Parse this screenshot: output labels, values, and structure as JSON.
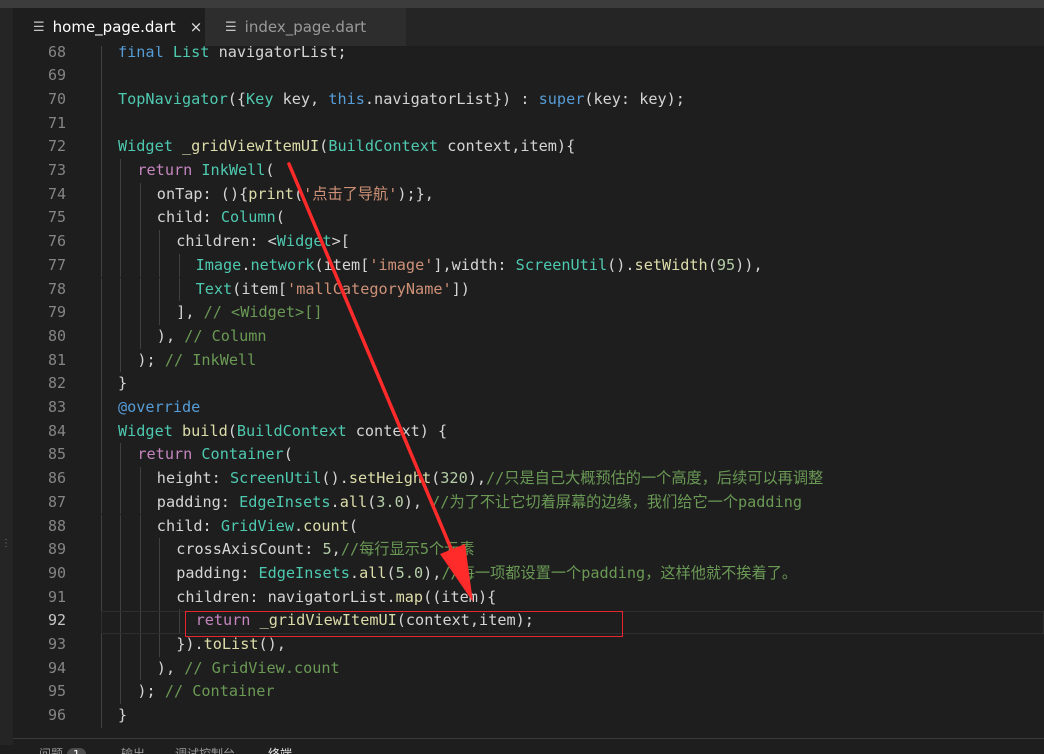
{
  "tabs": [
    {
      "label": "home_page.dart",
      "active": true,
      "icon": "lines-file-icon",
      "close": "×"
    },
    {
      "label": "index_page.dart",
      "active": false,
      "icon": "lines-file-icon"
    }
  ],
  "editor": {
    "active_line": 92,
    "lines": [
      {
        "n": "68",
        "indent": 1,
        "cut": true,
        "tokens": [
          {
            "t": "final ",
            "c": "kw"
          },
          {
            "t": "List ",
            "c": "ty"
          },
          {
            "t": "navigatorList;",
            "c": "pl"
          }
        ]
      },
      {
        "n": "69",
        "indent": 1,
        "tokens": []
      },
      {
        "n": "70",
        "indent": 1,
        "tokens": [
          {
            "t": "TopNavigator",
            "c": "ty"
          },
          {
            "t": "({",
            "c": "pl"
          },
          {
            "t": "Key ",
            "c": "ty"
          },
          {
            "t": "key, ",
            "c": "pl"
          },
          {
            "t": "this",
            "c": "kw"
          },
          {
            "t": ".navigatorList}) : ",
            "c": "pl"
          },
          {
            "t": "super",
            "c": "kw"
          },
          {
            "t": "(key: key);",
            "c": "pl"
          }
        ]
      },
      {
        "n": "71",
        "indent": 1,
        "tokens": []
      },
      {
        "n": "72",
        "indent": 1,
        "tokens": [
          {
            "t": "Widget ",
            "c": "ty"
          },
          {
            "t": "_gridViewItemUI",
            "c": "fn"
          },
          {
            "t": "(",
            "c": "pl"
          },
          {
            "t": "BuildContext ",
            "c": "ty"
          },
          {
            "t": "context,item){",
            "c": "pl"
          }
        ]
      },
      {
        "n": "73",
        "indent": 2,
        "tokens": [
          {
            "t": "return ",
            "c": "ctl"
          },
          {
            "t": "InkWell",
            "c": "ty"
          },
          {
            "t": "(",
            "c": "pl"
          }
        ]
      },
      {
        "n": "74",
        "indent": 3,
        "tokens": [
          {
            "t": "onTap: (){",
            "c": "pl"
          },
          {
            "t": "print",
            "c": "fn"
          },
          {
            "t": "(",
            "c": "pl"
          },
          {
            "t": "'点击了导航'",
            "c": "st"
          },
          {
            "t": ");},",
            "c": "pl"
          }
        ]
      },
      {
        "n": "75",
        "indent": 3,
        "tokens": [
          {
            "t": "child: ",
            "c": "pl"
          },
          {
            "t": "Column",
            "c": "ty"
          },
          {
            "t": "(",
            "c": "pl"
          }
        ]
      },
      {
        "n": "76",
        "indent": 4,
        "tokens": [
          {
            "t": "children: <",
            "c": "pl"
          },
          {
            "t": "Widget",
            "c": "ty"
          },
          {
            "t": ">[",
            "c": "pl"
          }
        ]
      },
      {
        "n": "77",
        "indent": 5,
        "tokens": [
          {
            "t": "Image",
            "c": "ty"
          },
          {
            "t": ".",
            "c": "pl"
          },
          {
            "t": "network",
            "c": "ty"
          },
          {
            "t": "(item[",
            "c": "pl"
          },
          {
            "t": "'image'",
            "c": "st"
          },
          {
            "t": "],width: ",
            "c": "pl"
          },
          {
            "t": "ScreenUtil",
            "c": "ty"
          },
          {
            "t": "().",
            "c": "pl"
          },
          {
            "t": "setWidth",
            "c": "fn"
          },
          {
            "t": "(",
            "c": "pl"
          },
          {
            "t": "95",
            "c": "nu"
          },
          {
            "t": ")),",
            "c": "pl"
          }
        ]
      },
      {
        "n": "78",
        "indent": 5,
        "tokens": [
          {
            "t": "Text",
            "c": "ty"
          },
          {
            "t": "(item[",
            "c": "pl"
          },
          {
            "t": "'mallCategoryName'",
            "c": "st"
          },
          {
            "t": "])",
            "c": "pl"
          }
        ]
      },
      {
        "n": "79",
        "indent": 4,
        "tokens": [
          {
            "t": "], ",
            "c": "pl"
          },
          {
            "t": "// <Widget>[]",
            "c": "cm"
          }
        ]
      },
      {
        "n": "80",
        "indent": 3,
        "tokens": [
          {
            "t": "), ",
            "c": "pl"
          },
          {
            "t": "// Column",
            "c": "cm"
          }
        ]
      },
      {
        "n": "81",
        "indent": 2,
        "tokens": [
          {
            "t": "); ",
            "c": "pl"
          },
          {
            "t": "// InkWell",
            "c": "cm"
          }
        ]
      },
      {
        "n": "82",
        "indent": 1,
        "tokens": [
          {
            "t": "}",
            "c": "pl"
          }
        ]
      },
      {
        "n": "83",
        "indent": 1,
        "tokens": [
          {
            "t": "@override",
            "c": "kw"
          }
        ]
      },
      {
        "n": "84",
        "indent": 1,
        "tokens": [
          {
            "t": "Widget ",
            "c": "ty"
          },
          {
            "t": "build",
            "c": "fn"
          },
          {
            "t": "(",
            "c": "pl"
          },
          {
            "t": "BuildContext ",
            "c": "ty"
          },
          {
            "t": "context) {",
            "c": "pl"
          }
        ]
      },
      {
        "n": "85",
        "indent": 2,
        "tokens": [
          {
            "t": "return ",
            "c": "ctl"
          },
          {
            "t": "Container",
            "c": "ty"
          },
          {
            "t": "(",
            "c": "pl"
          }
        ]
      },
      {
        "n": "86",
        "indent": 3,
        "tokens": [
          {
            "t": "height: ",
            "c": "pl"
          },
          {
            "t": "ScreenUtil",
            "c": "ty"
          },
          {
            "t": "().",
            "c": "pl"
          },
          {
            "t": "setHeight",
            "c": "fn"
          },
          {
            "t": "(",
            "c": "pl"
          },
          {
            "t": "320",
            "c": "nu"
          },
          {
            "t": "),",
            "c": "pl"
          },
          {
            "t": "//只是自己大概预估的一个高度，后续可以再调整",
            "c": "cm"
          }
        ]
      },
      {
        "n": "87",
        "indent": 3,
        "tokens": [
          {
            "t": "padding: ",
            "c": "pl"
          },
          {
            "t": "EdgeInsets",
            "c": "ty"
          },
          {
            "t": ".",
            "c": "pl"
          },
          {
            "t": "all",
            "c": "fn"
          },
          {
            "t": "(",
            "c": "pl"
          },
          {
            "t": "3.0",
            "c": "nu"
          },
          {
            "t": "), ",
            "c": "pl"
          },
          {
            "t": "//为了不让它切着屏幕的边缘，我们给它一个padding",
            "c": "cm"
          }
        ]
      },
      {
        "n": "88",
        "indent": 3,
        "tokens": [
          {
            "t": "child: ",
            "c": "pl"
          },
          {
            "t": "GridView",
            "c": "ty"
          },
          {
            "t": ".",
            "c": "pl"
          },
          {
            "t": "count",
            "c": "fn"
          },
          {
            "t": "(",
            "c": "pl"
          }
        ]
      },
      {
        "n": "89",
        "indent": 4,
        "tokens": [
          {
            "t": "crossAxisCount: ",
            "c": "pl"
          },
          {
            "t": "5",
            "c": "nu"
          },
          {
            "t": ",",
            "c": "pl"
          },
          {
            "t": "//每行显示5个元素",
            "c": "cm"
          }
        ]
      },
      {
        "n": "90",
        "indent": 4,
        "tokens": [
          {
            "t": "padding: ",
            "c": "pl"
          },
          {
            "t": "EdgeInsets",
            "c": "ty"
          },
          {
            "t": ".",
            "c": "pl"
          },
          {
            "t": "all",
            "c": "fn"
          },
          {
            "t": "(",
            "c": "pl"
          },
          {
            "t": "5.0",
            "c": "nu"
          },
          {
            "t": "),",
            "c": "pl"
          },
          {
            "t": "//每一项都设置一个padding，这样他就不挨着了。",
            "c": "cm"
          }
        ]
      },
      {
        "n": "91",
        "indent": 4,
        "tokens": [
          {
            "t": "children: navigatorList.",
            "c": "pl"
          },
          {
            "t": "map",
            "c": "fn"
          },
          {
            "t": "((item){",
            "c": "pl"
          }
        ]
      },
      {
        "n": "92",
        "indent": 5,
        "tokens": [
          {
            "t": "return ",
            "c": "ctl"
          },
          {
            "t": "_gridViewItemUI",
            "c": "fn"
          },
          {
            "t": "(context,item);",
            "c": "pl"
          }
        ]
      },
      {
        "n": "93",
        "indent": 4,
        "tokens": [
          {
            "t": "}).",
            "c": "pl"
          },
          {
            "t": "toList",
            "c": "fn"
          },
          {
            "t": "(),",
            "c": "pl"
          }
        ]
      },
      {
        "n": "94",
        "indent": 3,
        "tokens": [
          {
            "t": "), ",
            "c": "pl"
          },
          {
            "t": "// GridView.count",
            "c": "cm"
          }
        ]
      },
      {
        "n": "95",
        "indent": 2,
        "tokens": [
          {
            "t": "); ",
            "c": "pl"
          },
          {
            "t": "// Container",
            "c": "cm"
          }
        ]
      },
      {
        "n": "96",
        "indent": 1,
        "tokens": [
          {
            "t": "}",
            "c": "pl"
          }
        ]
      }
    ]
  },
  "annotation": {
    "arrow_color": "#ff2a2a",
    "box_color": "#e5262f"
  },
  "panel": {
    "tabs": [
      {
        "label": "问题",
        "badge": "1"
      },
      {
        "label": "输出"
      },
      {
        "label": "调试控制台"
      },
      {
        "label": "终端",
        "active": true
      }
    ]
  },
  "colors": {
    "keyword": "#569cd6",
    "control": "#c586c0",
    "type": "#4ec9b0",
    "function": "#dcdcaa",
    "string": "#ce9178",
    "comment": "#6a9955",
    "number": "#b5cea8",
    "text": "#d4d4d4",
    "background": "#1e1e1e"
  }
}
